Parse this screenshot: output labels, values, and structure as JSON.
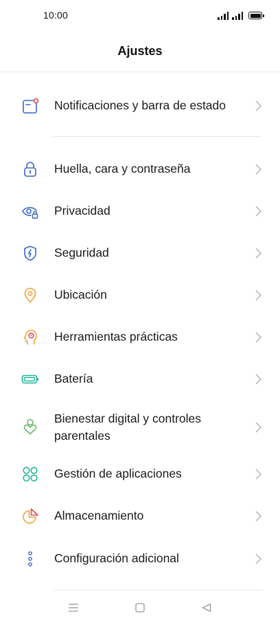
{
  "status_bar": {
    "time": "10:00"
  },
  "header": {
    "title": "Ajustes"
  },
  "items": [
    {
      "label": "Notificaciones y barra de estado"
    },
    {
      "label": "Huella, cara y contraseña"
    },
    {
      "label": "Privacidad"
    },
    {
      "label": "Seguridad"
    },
    {
      "label": "Ubicación"
    },
    {
      "label": "Herramientas prácticas"
    },
    {
      "label": "Batería"
    },
    {
      "label": "Bienestar digital y controles parentales"
    },
    {
      "label": "Gestión de aplicaciones"
    },
    {
      "label": "Almacenamiento"
    },
    {
      "label": "Configuración adicional"
    }
  ],
  "icons": {
    "notifications": "notification-bar-icon",
    "lock": "lock-icon",
    "privacy": "eye-lock-icon",
    "security": "shield-bolt-icon",
    "location": "location-pin-icon",
    "tools": "head-gear-icon",
    "battery": "battery-icon",
    "wellbeing": "person-heart-icon",
    "apps": "app-grid-icon",
    "storage": "pie-chart-icon",
    "more": "dots-icon"
  },
  "colors": {
    "blue_icon": "#3a66c4",
    "orange_icon": "#f0a53a",
    "teal_icon": "#1fb59a",
    "green_icon": "#6bb86f",
    "red_dot": "#e5484d",
    "text": "#1a1a1a",
    "chevron": "#b5b5b5"
  }
}
